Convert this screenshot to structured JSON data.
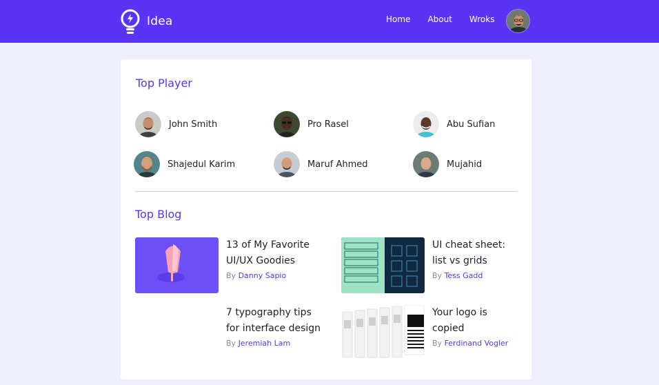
{
  "header": {
    "brand": "Idea",
    "nav": [
      {
        "label": "Home"
      },
      {
        "label": "About"
      },
      {
        "label": "Wroks"
      }
    ]
  },
  "top_player": {
    "title": "Top Player",
    "players": [
      {
        "name": "John Smith"
      },
      {
        "name": "Pro Rasel"
      },
      {
        "name": "Abu Sufian"
      },
      {
        "name": "Shajedul Karim"
      },
      {
        "name": "Maruf Ahmed"
      },
      {
        "name": "Mujahid"
      }
    ]
  },
  "top_blog": {
    "title": "Top Blog",
    "by_label": "By",
    "posts": [
      {
        "title_line1": "13 of My Favorite",
        "title_line2": "UI/UX Goodies",
        "author": "Danny Sapio"
      },
      {
        "title_line1": "UI cheat sheet:",
        "title_line2": "list vs grids",
        "author": "Tess Gadd"
      },
      {
        "title_line1": "7 typography tips",
        "title_line2": "for interface design",
        "author": "Jeremiah Lam"
      },
      {
        "title_line1": "Your logo is",
        "title_line2": "copied",
        "author": "Ferdinand Vogler"
      }
    ]
  }
}
